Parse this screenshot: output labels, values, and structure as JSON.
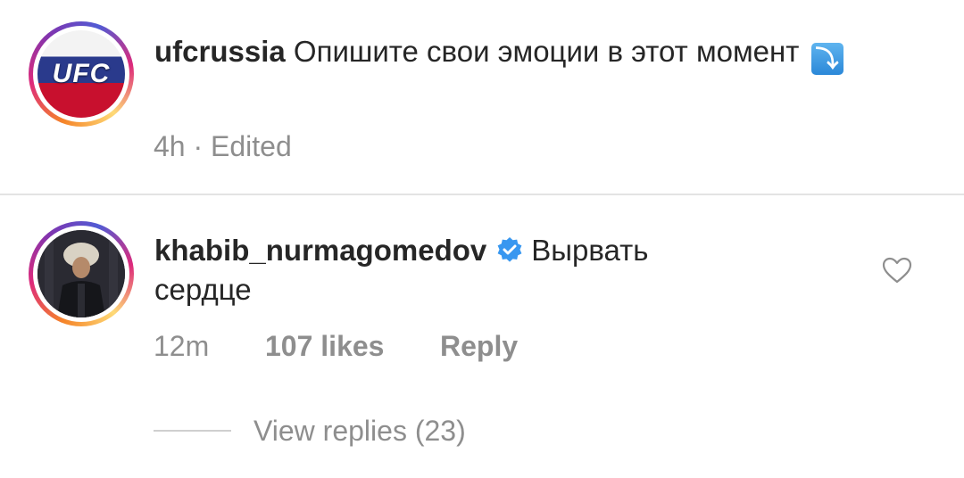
{
  "post": {
    "username": "ufcrussia",
    "caption": "Опишите свои эмоции в этот момент",
    "emoji_icon": "arrow-down-right-emoji-icon",
    "time": "4h",
    "separator": "·",
    "edited": "Edited",
    "avatar_logo_text": "UFC"
  },
  "comment": {
    "username": "khabib_nurmagomedov",
    "verified_icon": "verified-badge-icon",
    "text_line1": "Вырвать",
    "text_line2": "сердце",
    "time": "12m",
    "likes": "107 likes",
    "reply_label": "Reply",
    "view_replies": "View replies (23)",
    "like_icon": "heart-outline-icon"
  },
  "colors": {
    "text": "#262626",
    "muted": "#8e8e8e",
    "verified_blue": "#3897f0",
    "divider": "#e3e3e3"
  }
}
